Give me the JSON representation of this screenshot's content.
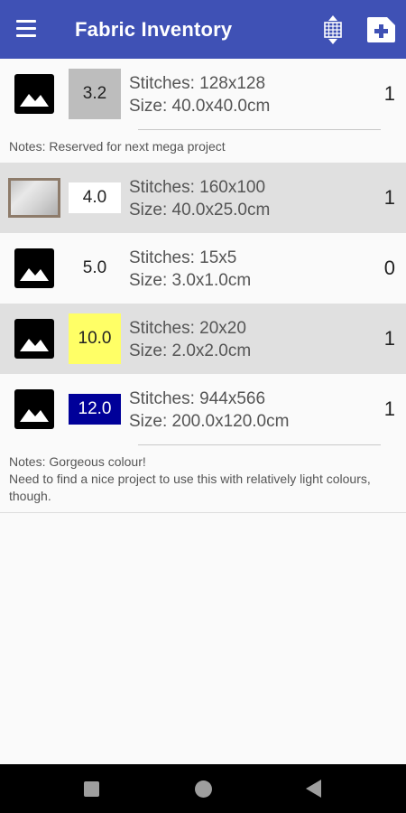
{
  "app": {
    "title": "Fabric Inventory",
    "bar_color": "#3f51b5",
    "menu_icon": "hamburger-icon",
    "sort_icon": "sort-grid-icon",
    "add_icon": "add-item-icon"
  },
  "items": [
    {
      "thumbnail": "image-placeholder-icon",
      "count": "3.2",
      "count_bg": "#bdbdbd",
      "count_color": "#222222",
      "stitches": "Stitches: 128x128",
      "size": "Size: 40.0x40.0cm",
      "quantity": "1",
      "notes": "Notes: Reserved for next mega project"
    },
    {
      "thumbnail": "fabric-photo",
      "count": "4.0",
      "count_bg": "#ffffff",
      "count_color": "#222222",
      "stitches": "Stitches: 160x100",
      "size": "Size: 40.0x25.0cm",
      "quantity": "1"
    },
    {
      "thumbnail": "image-placeholder-icon",
      "count": "5.0",
      "count_bg": "#fafafa",
      "count_color": "#222222",
      "stitches": "Stitches: 15x5",
      "size": "Size: 3.0x1.0cm",
      "quantity": "0"
    },
    {
      "thumbnail": "image-placeholder-icon",
      "count": "10.0",
      "count_bg": "#ffff66",
      "count_color": "#222222",
      "stitches": "Stitches: 20x20",
      "size": "Size: 2.0x2.0cm",
      "quantity": "1"
    },
    {
      "thumbnail": "image-placeholder-icon",
      "count": "12.0",
      "count_bg": "#000099",
      "count_color": "#ffffff",
      "stitches": "Stitches: 944x566",
      "size": "Size: 200.0x120.0cm",
      "quantity": "1",
      "notes": "Notes: Gorgeous colour!\nNeed to find a nice project to use this with relatively light colours, though."
    }
  ],
  "navbar": {
    "recents_icon": "square-recents-icon",
    "home_icon": "circle-home-icon",
    "back_icon": "triangle-back-icon"
  }
}
